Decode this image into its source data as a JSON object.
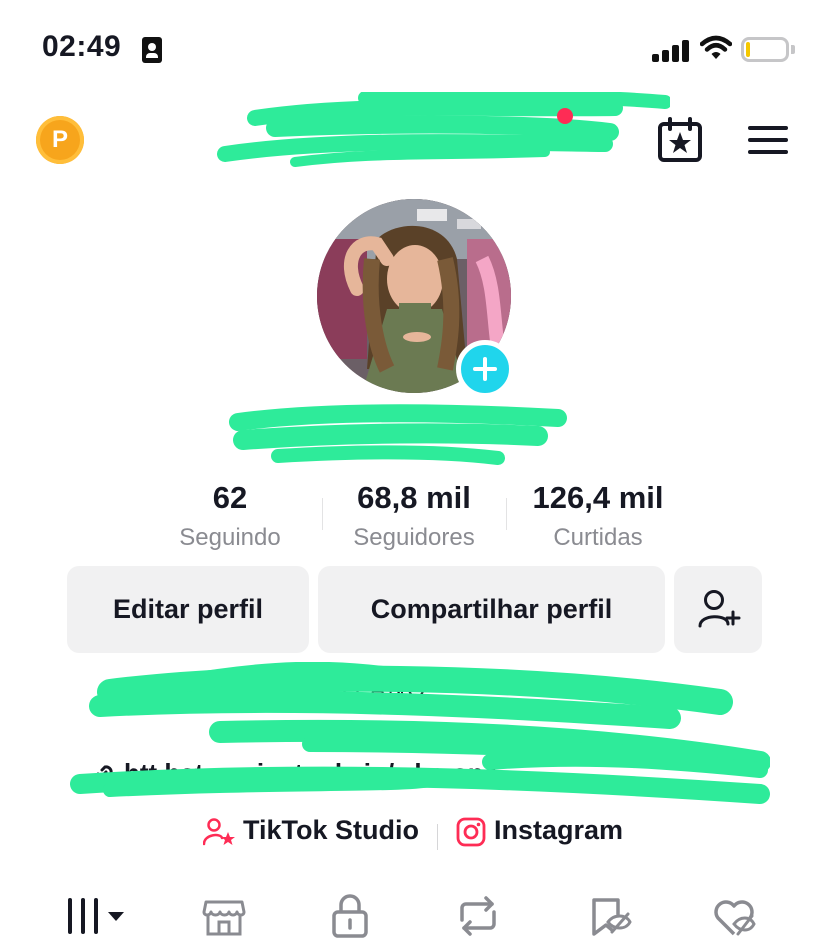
{
  "status_bar": {
    "time": "02:49",
    "battery_level": 0.1,
    "battery_color": "#f5c800"
  },
  "header": {
    "coin_label": "P",
    "coin_color": "#f7a51c",
    "notification_dot_color": "#fe2c55",
    "calendar_icon": "calendar-star-icon",
    "menu_icon": "hamburger-menu-icon"
  },
  "profile": {
    "add_button_color": "#20d5ec"
  },
  "stats": [
    {
      "value": "62",
      "label": "Seguindo"
    },
    {
      "value": "68,8 mil",
      "label": "Seguidores"
    },
    {
      "value": "126,4 mil",
      "label": "Curtidas"
    }
  ],
  "actions": {
    "edit_profile": "Editar perfil",
    "share_profile": "Compartilhar perfil",
    "add_friend_icon": "add-user-icon"
  },
  "bio": {
    "line1": "CHOU      VIDA        TUDO       ANO",
    "link": "htt      hat.geniustools.io/wha      ona..."
  },
  "shortcuts": [
    {
      "label": "TikTok Studio",
      "icon": "tiktok-studio-icon",
      "color": "#fe2c55"
    },
    {
      "label": "Instagram",
      "icon": "instagram-icon",
      "color": "#fe2c55"
    }
  ],
  "tabs": [
    {
      "icon": "videos-grid-icon"
    },
    {
      "icon": "shop-icon"
    },
    {
      "icon": "private-lock-icon"
    },
    {
      "icon": "repost-icon"
    },
    {
      "icon": "favorites-icon"
    },
    {
      "icon": "liked-icon"
    }
  ]
}
